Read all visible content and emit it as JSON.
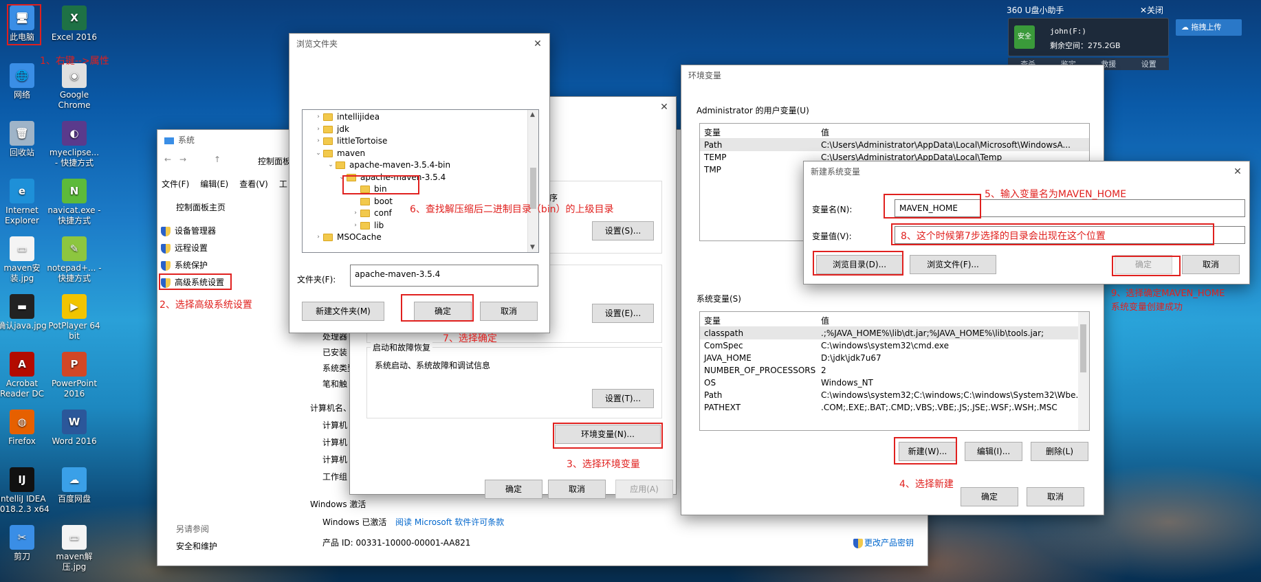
{
  "desktop": {
    "icons": [
      {
        "label": "此电脑",
        "color": "#3a8ee6",
        "glyph": "🖥"
      },
      {
        "label": "Excel 2016",
        "color": "#1e7145",
        "glyph": "X"
      },
      {
        "label": "网络",
        "color": "#3a8ee6",
        "glyph": "🌐"
      },
      {
        "label": "Google Chrome",
        "color": "#e0e0e0",
        "glyph": "◉"
      },
      {
        "label": "回收站",
        "color": "#9fb4c8",
        "glyph": "🗑"
      },
      {
        "label": "myeclipse... - 快捷方式",
        "color": "#5a3a8c",
        "glyph": "◐"
      },
      {
        "label": "Internet Explorer",
        "color": "#1e90d8",
        "glyph": "e"
      },
      {
        "label": "navicat.exe - 快捷方式",
        "color": "#5dba3a",
        "glyph": "N"
      },
      {
        "label": "maven安装.jpg",
        "color": "#f4f4f4",
        "glyph": "▭"
      },
      {
        "label": "notepad+... - 快捷方式",
        "color": "#8dc63f",
        "glyph": "✎"
      },
      {
        "label": "确认java.jpg",
        "color": "#222",
        "glyph": "▬"
      },
      {
        "label": "PotPlayer 64 bit",
        "color": "#f2c400",
        "glyph": "▶"
      },
      {
        "label": "Acrobat Reader DC",
        "color": "#b30b00",
        "glyph": "A"
      },
      {
        "label": "PowerPoint 2016",
        "color": "#d24726",
        "glyph": "P"
      },
      {
        "label": "Firefox",
        "color": "#e66000",
        "glyph": "◍"
      },
      {
        "label": "Word 2016",
        "color": "#2b579a",
        "glyph": "W"
      },
      {
        "label": "IntelliJ IDEA 2018.2.3 x64",
        "color": "#111",
        "glyph": "IJ"
      },
      {
        "label": "百度网盘",
        "color": "#3aa0e8",
        "glyph": "☁"
      },
      {
        "label": "剪刀",
        "color": "#3a8ee6",
        "glyph": "✂"
      },
      {
        "label": "maven解压.jpg",
        "color": "#f4f4f4",
        "glyph": "▭"
      }
    ]
  },
  "u360": {
    "title": "360 U盘小助手",
    "close": "✕关闭",
    "drive": "john(F:)",
    "space": "剩余空间：275.2GB",
    "safe": "安全",
    "tabs": [
      "查杀",
      "鉴定",
      "救援",
      "设置"
    ],
    "upload": "拖拽上传"
  },
  "system": {
    "title": "系统",
    "breadcrumb": "控制面板",
    "menu": [
      "文件(F)",
      "编辑(E)",
      "查看(V)",
      "工"
    ],
    "home": "控制面板主页",
    "links": [
      "设备管理器",
      "远程设置",
      "系统保护",
      "高级系统设置"
    ],
    "see_also": "另请参阅",
    "security": "安全和维护",
    "info": [
      "处理器",
      "已安装",
      "系统类型",
      "笔和触"
    ],
    "comp_head": "计算机名、",
    "comp_rows": [
      "计算机",
      "计算机",
      "计算机",
      "工作组"
    ],
    "win_head": "Windows 激活",
    "activated": "Windows 已激活",
    "license": "阅读 Microsoft 软件许可条款",
    "product": "产品 ID: 00331-10000-00001-AA821",
    "change_key": "更改产品密钥"
  },
  "sysprops": {
    "perf_frag": "序",
    "startup_title": "启动和故障恢复",
    "startup_desc": "系统启动、系统故障和调试信息",
    "set1": "设置(S)...",
    "set2": "设置(E)...",
    "set3": "设置(T)...",
    "envbtn": "环境变量(N)...",
    "ok": "确定",
    "cancel": "取消",
    "apply": "应用(A)"
  },
  "browse": {
    "title": "浏览文件夹",
    "tree": [
      {
        "label": "intellijidea",
        "chev": "›",
        "indent": 0
      },
      {
        "label": "jdk",
        "chev": "›",
        "indent": 0
      },
      {
        "label": "littleTortoise",
        "chev": "›",
        "indent": 0
      },
      {
        "label": "maven",
        "chev": "⌄",
        "indent": 0
      },
      {
        "label": "apache-maven-3.5.4-bin",
        "chev": "⌄",
        "indent": 1
      },
      {
        "label": "apache-maven-3.5.4",
        "chev": "⌄",
        "indent": 2
      },
      {
        "label": "bin",
        "chev": "",
        "indent": 3
      },
      {
        "label": "boot",
        "chev": "",
        "indent": 3
      },
      {
        "label": "conf",
        "chev": "›",
        "indent": 3
      },
      {
        "label": "lib",
        "chev": "›",
        "indent": 3
      },
      {
        "label": "MSOCache",
        "chev": "›",
        "indent": 0
      }
    ],
    "folder_label": "文件夹(F):",
    "folder_value": "apache-maven-3.5.4",
    "newfolder": "新建文件夹(M)",
    "ok": "确定",
    "cancel": "取消"
  },
  "env": {
    "title": "环境变量",
    "user_head": "Administrator 的用户变量(U)",
    "col_var": "变量",
    "col_val": "值",
    "user_vars": [
      {
        "var": "Path",
        "val": "C:\\Users\\Administrator\\AppData\\Local\\Microsoft\\WindowsA..."
      },
      {
        "var": "TEMP",
        "val": "C:\\Users\\Administrator\\AppData\\Local\\Temp"
      },
      {
        "var": "TMP",
        "val": ""
      }
    ],
    "sys_head": "系统变量(S)",
    "sys_vars": [
      {
        "var": "classpath",
        "val": ".;%JAVA_HOME%\\lib\\dt.jar;%JAVA_HOME%\\lib\\tools.jar;"
      },
      {
        "var": "ComSpec",
        "val": "C:\\windows\\system32\\cmd.exe"
      },
      {
        "var": "JAVA_HOME",
        "val": "D:\\jdk\\jdk7u67"
      },
      {
        "var": "NUMBER_OF_PROCESSORS",
        "val": "2"
      },
      {
        "var": "OS",
        "val": "Windows_NT"
      },
      {
        "var": "Path",
        "val": "C:\\windows\\system32;C:\\windows;C:\\windows\\System32\\Wbe..."
      },
      {
        "var": "PATHEXT",
        "val": ".COM;.EXE;.BAT;.CMD;.VBS;.VBE;.JS;.JSE;.WSF;.WSH;.MSC"
      }
    ],
    "new": "新建(W)...",
    "edit": "编辑(I)...",
    "delete": "删除(L)",
    "ok": "确定",
    "cancel": "取消"
  },
  "newvar": {
    "title": "新建系统变量",
    "name_label": "变量名(N):",
    "name_value": "MAVEN_HOME",
    "val_label": "变量值(V):",
    "val_value": "",
    "browse_dir": "浏览目录(D)...",
    "browse_file": "浏览文件(F)...",
    "ok": "确定",
    "cancel": "取消"
  },
  "annotations": {
    "a1": "1、右键-->属性",
    "a2": "2、选择高级系统设置",
    "a3": "3、选择环境变量",
    "a4": "4、选择新建",
    "a5": "5、输入变量名为MAVEN_HOME",
    "a6": "6、查找解压缩后二进制目录（bin）的上级目录",
    "a7": "7、选择确定",
    "a8": "8、这个时候第7步选择的目录会出现在这个位置",
    "a9a": "9、选择确定MAVEN_HOME",
    "a9b": "系统变量创建成功"
  }
}
